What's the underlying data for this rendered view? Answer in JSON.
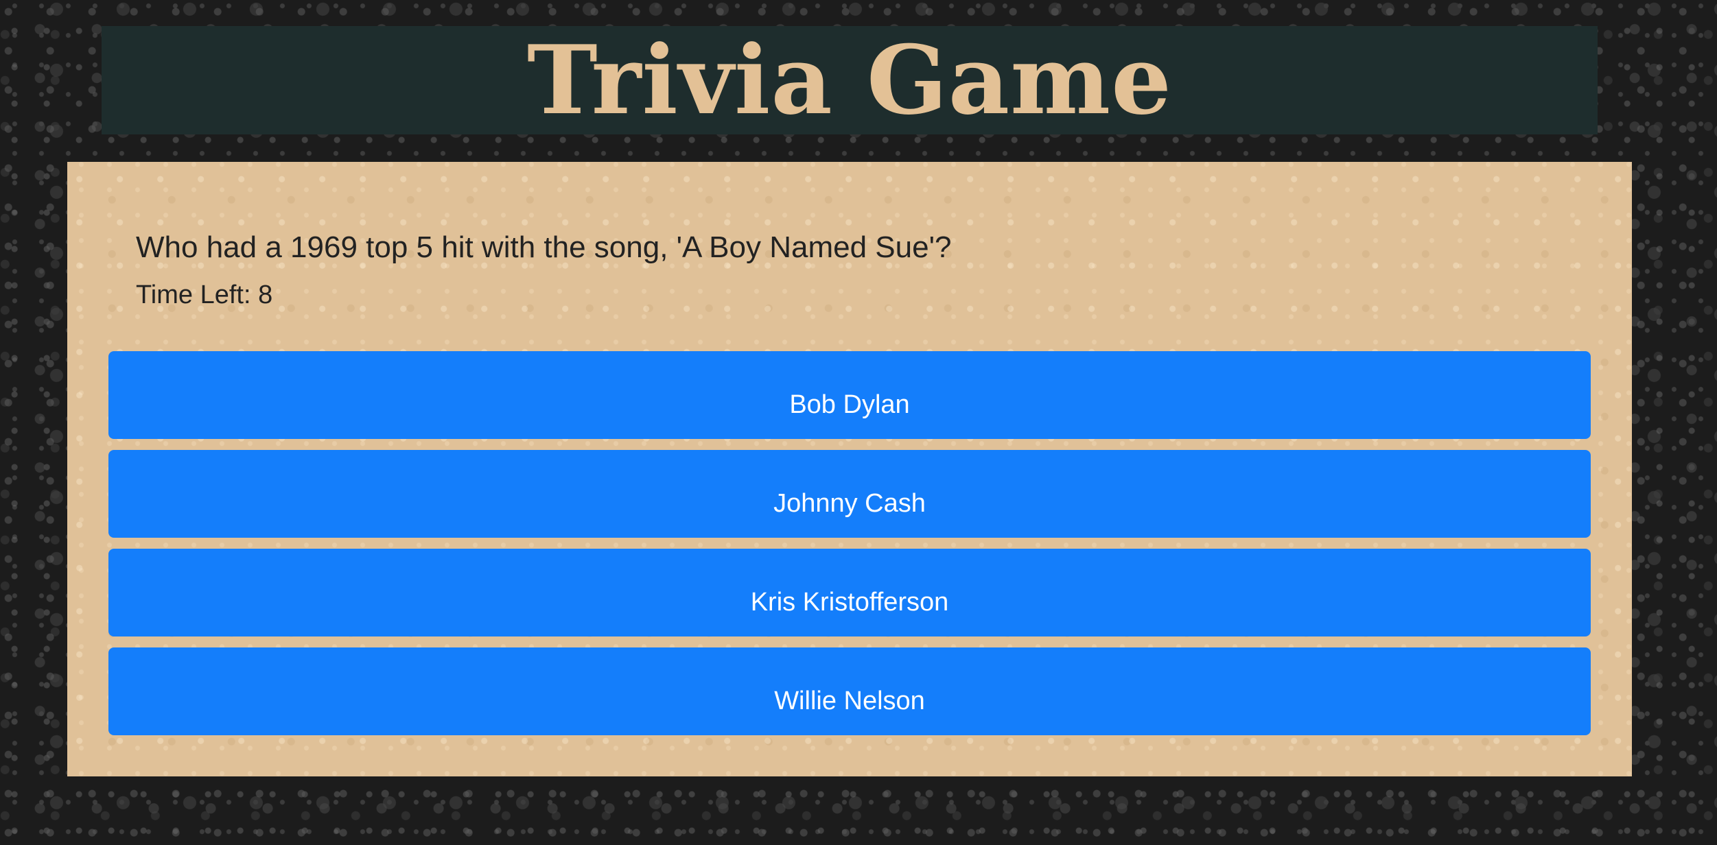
{
  "header": {
    "title": "Trivia Game"
  },
  "question": {
    "text": "Who had a 1969 top 5 hit with the song, 'A Boy Named Sue'?",
    "timer_label": "Time Left:",
    "time_left": "8"
  },
  "answers": [
    {
      "label": "Bob Dylan"
    },
    {
      "label": "Johnny Cash"
    },
    {
      "label": "Kris Kristofferson"
    },
    {
      "label": "Willie Nelson"
    }
  ],
  "colors": {
    "page_background": "#1c1c1c",
    "banner_background": "#1e2d2d",
    "title_text": "#e3c196",
    "panel_background": "#e0c198",
    "answer_button": "#147efb",
    "answer_text": "#ffffff",
    "question_text": "#222222"
  }
}
